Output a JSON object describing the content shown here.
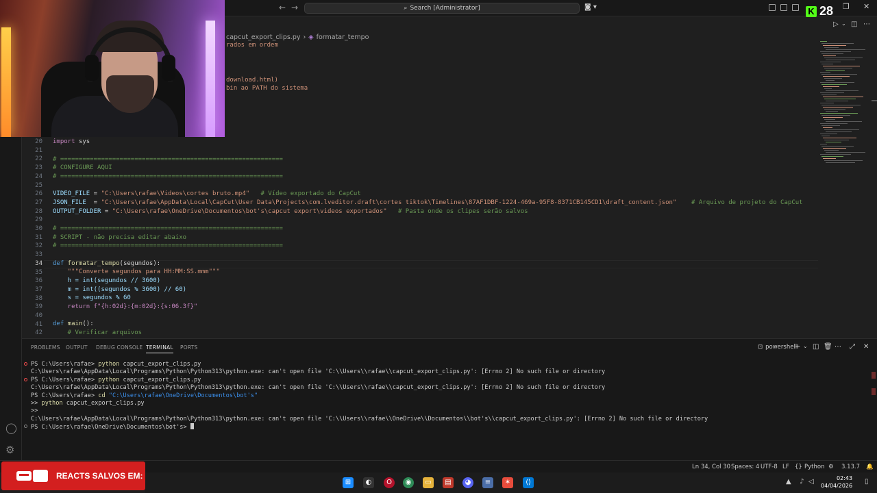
{
  "titlebar": {
    "search_text": "Search [Administrator]",
    "kick_viewers": "28"
  },
  "breadcrumb": {
    "file": "capcut_export_clips.py",
    "symbol": "formatar_tempo"
  },
  "editor_top_fragments": [
    "rados em ordem",
    "",
    "",
    "",
    "download.html)",
    "bin ao PATH do sistema"
  ],
  "line_numbers": [
    "20",
    "21",
    "22",
    "23",
    "24",
    "25",
    "26",
    "27",
    "28",
    "29",
    "30",
    "31",
    "32",
    "33",
    "34",
    "35",
    "36",
    "37",
    "38",
    "39",
    "40",
    "41",
    "42"
  ],
  "active_line": "34",
  "code": {
    "l20_kw": "import",
    "l20_mod": " sys",
    "l22": "# ============================================================",
    "l23": "# CONFIGURE AQUI",
    "l24": "# ============================================================",
    "l26_var": "VIDEO_FILE",
    "l26_eq": " = ",
    "l26_str": "\"C:\\Users\\rafae\\Videos\\cortes bruto.mp4\"",
    "l26_cmt": "   # Vídeo exportado do CapCut",
    "l27_var": "JSON_FILE",
    "l27_eq": "  = ",
    "l27_str": "\"C:\\Users\\rafae\\AppData\\Local\\CapCut\\User Data\\Projects\\com.lveditor.draft\\cortes tiktok\\Timelines\\87AF1DBF-1224-469a-95F8-8371CB145CD1\\draft_content.json\"",
    "l27_cmt": "    # Arquivo de projeto do CapCut",
    "l28_var": "OUTPUT_FOLDER",
    "l28_eq": " = ",
    "l28_str": "\"C:\\Users\\rafae\\OneDrive\\Documentos\\bot's\\capcut export\\videos exportados\"",
    "l28_cmt": "   # Pasta onde os clipes serão salvos",
    "l30": "# ============================================================",
    "l31": "# SCRIPT - não precisa editar abaixo",
    "l32": "# ============================================================",
    "l34_def": "def",
    "l34_fn": " formatar_tempo",
    "l34_args": "(segundos):",
    "l35": "    \"\"\"Converte segundos para HH:MM:SS.mmm\"\"\"",
    "l36": "    h = int(segundos // 3600)",
    "l37": "    m = int((segundos % 3600) // 60)",
    "l38": "    s = segundos % 60",
    "l39": "    return f\"{h:02d}:{m:02d}:{s:06.3f}\"",
    "l41_def": "def",
    "l41_fn": " main",
    "l41_args": "():",
    "l42": "    # Verificar arquivos"
  },
  "panel": {
    "tabs": [
      "PROBLEMS",
      "OUTPUT",
      "DEBUG CONSOLE",
      "TERMINAL",
      "PORTS"
    ],
    "active_tab": "TERMINAL",
    "shell": "powershell"
  },
  "terminal": {
    "lines": [
      {
        "prompt": "PS C:\\Users\\rafae> ",
        "cmd": "python",
        "rest": " capcut_export_clips.py",
        "marker": "error"
      },
      {
        "prompt": "",
        "cmd": "",
        "rest": "C:\\Users\\rafae\\AppData\\Local\\Programs\\Python\\Python313\\python.exe: can't open file 'C:\\\\Users\\\\rafae\\\\capcut_export_clips.py': [Errno 2] No such file or directory",
        "marker": ""
      },
      {
        "prompt": "PS C:\\Users\\rafae> ",
        "cmd": "python",
        "rest": " capcut_export_clips.py",
        "marker": "error"
      },
      {
        "prompt": "",
        "cmd": "",
        "rest": "C:\\Users\\rafae\\AppData\\Local\\Programs\\Python\\Python313\\python.exe: can't open file 'C:\\\\Users\\\\rafae\\\\capcut_export_clips.py': [Errno 2] No such file or directory",
        "marker": ""
      },
      {
        "prompt": "PS C:\\Users\\rafae> ",
        "cmd": "cd",
        "rest": " \"C:\\Users\\rafae\\OneDrive\\Documentos\\bot's\"",
        "marker": ""
      },
      {
        "prompt": ">> ",
        "cmd": "python",
        "rest": " capcut_export_clips.py",
        "marker": ""
      },
      {
        "prompt": ">>",
        "cmd": "",
        "rest": "",
        "marker": ""
      },
      {
        "prompt": "",
        "cmd": "",
        "rest": "C:\\Users\\rafae\\AppData\\Local\\Programs\\Python\\Python313\\python.exe: can't open file 'C:\\\\Users\\\\rafae\\\\OneDrive\\\\Documentos\\\\bot's\\\\capcut_export_clips.py': [Errno 2] No such file or directory",
        "marker": ""
      },
      {
        "prompt": "PS C:\\Users\\rafae\\OneDrive\\Documentos\\bot's> ",
        "cmd": "",
        "rest": "",
        "marker": "neutral"
      }
    ]
  },
  "statusbar": {
    "position": "Ln 34, Col 30",
    "spaces": "Spaces: 4",
    "encoding": "UTF-8",
    "eol": "LF",
    "language": "Python",
    "version": "3.13.7"
  },
  "overlay": {
    "banner_text": "REACTS SALVOS EM:"
  },
  "taskbar": {
    "time": "02:43",
    "date": "04/04/2026"
  }
}
